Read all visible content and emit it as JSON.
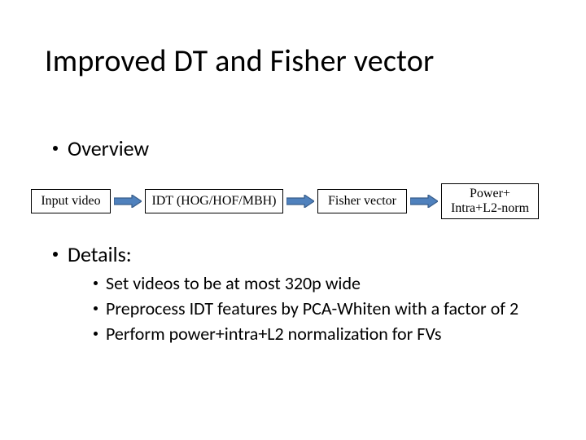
{
  "title": "Improved DT and Fisher vector",
  "overview_label": "Overview",
  "flow": {
    "step1": "Input video",
    "step2": "IDT (HOG/HOF/MBH)",
    "step3": "Fisher vector",
    "step4": "Power+\nIntra+L2-norm"
  },
  "details_label": "Details:",
  "details_items": [
    "Set videos to be at most 320p wide",
    "Preprocess IDT features by PCA-Whiten with a factor of 2",
    "Perform power+intra+L2 normalization for FVs"
  ],
  "colors": {
    "arrow_fill": "#4F81BD",
    "arrow_stroke": "#385D8A"
  }
}
